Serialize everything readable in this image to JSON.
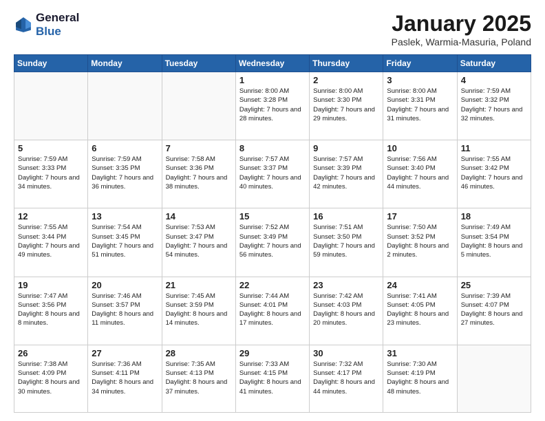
{
  "logo": {
    "line1": "General",
    "line2": "Blue"
  },
  "title": "January 2025",
  "location": "Paslek, Warmia-Masuria, Poland",
  "days_header": [
    "Sunday",
    "Monday",
    "Tuesday",
    "Wednesday",
    "Thursday",
    "Friday",
    "Saturday"
  ],
  "weeks": [
    [
      {
        "day": "",
        "sunrise": "",
        "sunset": "",
        "daylight": ""
      },
      {
        "day": "",
        "sunrise": "",
        "sunset": "",
        "daylight": ""
      },
      {
        "day": "",
        "sunrise": "",
        "sunset": "",
        "daylight": ""
      },
      {
        "day": "1",
        "sunrise": "Sunrise: 8:00 AM",
        "sunset": "Sunset: 3:28 PM",
        "daylight": "Daylight: 7 hours and 28 minutes."
      },
      {
        "day": "2",
        "sunrise": "Sunrise: 8:00 AM",
        "sunset": "Sunset: 3:30 PM",
        "daylight": "Daylight: 7 hours and 29 minutes."
      },
      {
        "day": "3",
        "sunrise": "Sunrise: 8:00 AM",
        "sunset": "Sunset: 3:31 PM",
        "daylight": "Daylight: 7 hours and 31 minutes."
      },
      {
        "day": "4",
        "sunrise": "Sunrise: 7:59 AM",
        "sunset": "Sunset: 3:32 PM",
        "daylight": "Daylight: 7 hours and 32 minutes."
      }
    ],
    [
      {
        "day": "5",
        "sunrise": "Sunrise: 7:59 AM",
        "sunset": "Sunset: 3:33 PM",
        "daylight": "Daylight: 7 hours and 34 minutes."
      },
      {
        "day": "6",
        "sunrise": "Sunrise: 7:59 AM",
        "sunset": "Sunset: 3:35 PM",
        "daylight": "Daylight: 7 hours and 36 minutes."
      },
      {
        "day": "7",
        "sunrise": "Sunrise: 7:58 AM",
        "sunset": "Sunset: 3:36 PM",
        "daylight": "Daylight: 7 hours and 38 minutes."
      },
      {
        "day": "8",
        "sunrise": "Sunrise: 7:57 AM",
        "sunset": "Sunset: 3:37 PM",
        "daylight": "Daylight: 7 hours and 40 minutes."
      },
      {
        "day": "9",
        "sunrise": "Sunrise: 7:57 AM",
        "sunset": "Sunset: 3:39 PM",
        "daylight": "Daylight: 7 hours and 42 minutes."
      },
      {
        "day": "10",
        "sunrise": "Sunrise: 7:56 AM",
        "sunset": "Sunset: 3:40 PM",
        "daylight": "Daylight: 7 hours and 44 minutes."
      },
      {
        "day": "11",
        "sunrise": "Sunrise: 7:55 AM",
        "sunset": "Sunset: 3:42 PM",
        "daylight": "Daylight: 7 hours and 46 minutes."
      }
    ],
    [
      {
        "day": "12",
        "sunrise": "Sunrise: 7:55 AM",
        "sunset": "Sunset: 3:44 PM",
        "daylight": "Daylight: 7 hours and 49 minutes."
      },
      {
        "day": "13",
        "sunrise": "Sunrise: 7:54 AM",
        "sunset": "Sunset: 3:45 PM",
        "daylight": "Daylight: 7 hours and 51 minutes."
      },
      {
        "day": "14",
        "sunrise": "Sunrise: 7:53 AM",
        "sunset": "Sunset: 3:47 PM",
        "daylight": "Daylight: 7 hours and 54 minutes."
      },
      {
        "day": "15",
        "sunrise": "Sunrise: 7:52 AM",
        "sunset": "Sunset: 3:49 PM",
        "daylight": "Daylight: 7 hours and 56 minutes."
      },
      {
        "day": "16",
        "sunrise": "Sunrise: 7:51 AM",
        "sunset": "Sunset: 3:50 PM",
        "daylight": "Daylight: 7 hours and 59 minutes."
      },
      {
        "day": "17",
        "sunrise": "Sunrise: 7:50 AM",
        "sunset": "Sunset: 3:52 PM",
        "daylight": "Daylight: 8 hours and 2 minutes."
      },
      {
        "day": "18",
        "sunrise": "Sunrise: 7:49 AM",
        "sunset": "Sunset: 3:54 PM",
        "daylight": "Daylight: 8 hours and 5 minutes."
      }
    ],
    [
      {
        "day": "19",
        "sunrise": "Sunrise: 7:47 AM",
        "sunset": "Sunset: 3:56 PM",
        "daylight": "Daylight: 8 hours and 8 minutes."
      },
      {
        "day": "20",
        "sunrise": "Sunrise: 7:46 AM",
        "sunset": "Sunset: 3:57 PM",
        "daylight": "Daylight: 8 hours and 11 minutes."
      },
      {
        "day": "21",
        "sunrise": "Sunrise: 7:45 AM",
        "sunset": "Sunset: 3:59 PM",
        "daylight": "Daylight: 8 hours and 14 minutes."
      },
      {
        "day": "22",
        "sunrise": "Sunrise: 7:44 AM",
        "sunset": "Sunset: 4:01 PM",
        "daylight": "Daylight: 8 hours and 17 minutes."
      },
      {
        "day": "23",
        "sunrise": "Sunrise: 7:42 AM",
        "sunset": "Sunset: 4:03 PM",
        "daylight": "Daylight: 8 hours and 20 minutes."
      },
      {
        "day": "24",
        "sunrise": "Sunrise: 7:41 AM",
        "sunset": "Sunset: 4:05 PM",
        "daylight": "Daylight: 8 hours and 23 minutes."
      },
      {
        "day": "25",
        "sunrise": "Sunrise: 7:39 AM",
        "sunset": "Sunset: 4:07 PM",
        "daylight": "Daylight: 8 hours and 27 minutes."
      }
    ],
    [
      {
        "day": "26",
        "sunrise": "Sunrise: 7:38 AM",
        "sunset": "Sunset: 4:09 PM",
        "daylight": "Daylight: 8 hours and 30 minutes."
      },
      {
        "day": "27",
        "sunrise": "Sunrise: 7:36 AM",
        "sunset": "Sunset: 4:11 PM",
        "daylight": "Daylight: 8 hours and 34 minutes."
      },
      {
        "day": "28",
        "sunrise": "Sunrise: 7:35 AM",
        "sunset": "Sunset: 4:13 PM",
        "daylight": "Daylight: 8 hours and 37 minutes."
      },
      {
        "day": "29",
        "sunrise": "Sunrise: 7:33 AM",
        "sunset": "Sunset: 4:15 PM",
        "daylight": "Daylight: 8 hours and 41 minutes."
      },
      {
        "day": "30",
        "sunrise": "Sunrise: 7:32 AM",
        "sunset": "Sunset: 4:17 PM",
        "daylight": "Daylight: 8 hours and 44 minutes."
      },
      {
        "day": "31",
        "sunrise": "Sunrise: 7:30 AM",
        "sunset": "Sunset: 4:19 PM",
        "daylight": "Daylight: 8 hours and 48 minutes."
      },
      {
        "day": "",
        "sunrise": "",
        "sunset": "",
        "daylight": ""
      }
    ]
  ]
}
